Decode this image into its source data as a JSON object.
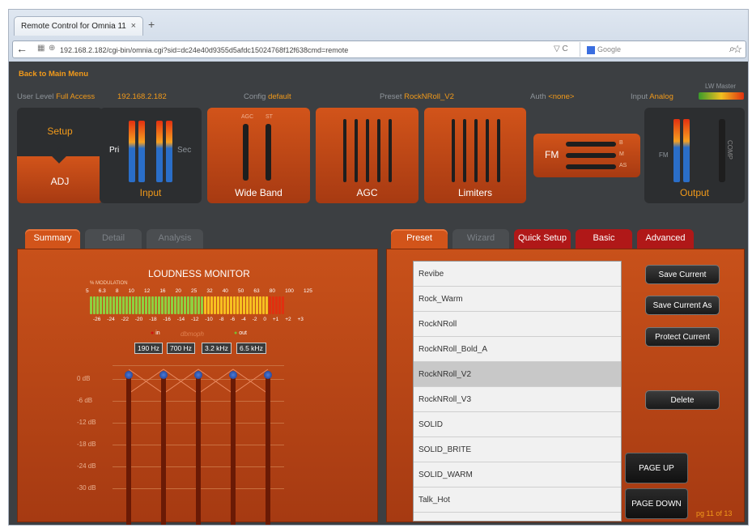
{
  "browser": {
    "tab_title": "Remote Control for Omnia 11",
    "close": "×",
    "new_tab": "+",
    "back": "←",
    "url": "192.168.2.182/cgi-bin/omnia.cgi?sid=dc24e40d9355d5afdc15024768f12f638cmd=remote",
    "search_placeholder": "Google",
    "reload": "▽ C",
    "star": "☆",
    "search_icon": "⌕"
  },
  "app": {
    "back_to_main": "Back to Main Menu",
    "user_level_label": "User Level",
    "user_level": "Full Access",
    "ip": "192.168.2.182",
    "config_label": "Config",
    "config": "default",
    "preset_label": "Preset",
    "preset": "RockNRoll_V2",
    "auth_label": "Auth",
    "auth": "<none>",
    "input_label": "Input",
    "input": "Analog",
    "lw_master": "LW Master"
  },
  "chain": {
    "setup": "Setup",
    "adj": "ADJ",
    "input": "Input",
    "pri": "Pri",
    "sec": "Sec",
    "wideband": "Wide Band",
    "agc_l": "AGC",
    "st_l": "ST",
    "agc": "AGC",
    "limiters": "Limiters",
    "fm": "FM",
    "b": "B",
    "m": "M",
    "as": "AS",
    "output": "Output",
    "out_fm": "FM",
    "comp": "COMP"
  },
  "left_tabs": {
    "summary": "Summary",
    "detail": "Detail",
    "analysis": "Analysis"
  },
  "right_tabs": {
    "preset": "Preset",
    "wizard": "Wizard",
    "quick_setup": "Quick Setup",
    "basic": "Basic",
    "advanced": "Advanced"
  },
  "loudness": {
    "title": "LOUDNESS MONITOR",
    "in": "in",
    "out": "out",
    "brand": "dbmoph",
    "percent_mod": "% MODULATION",
    "scale_top": [
      "5",
      "6.3",
      "8",
      "10",
      "12",
      "16",
      "20",
      "25",
      "32",
      "40",
      "50",
      "63",
      "80",
      "100",
      "125"
    ],
    "scale_bottom": [
      "-26",
      "-24",
      "-22",
      "-20",
      "-18",
      "-16",
      "-14",
      "-12",
      "-10",
      "-8",
      "-6",
      "-4",
      "-2",
      "0",
      "+1",
      "+2",
      "+3"
    ]
  },
  "eq": {
    "freqs": [
      "190 Hz",
      "700 Hz",
      "3.2 kHz",
      "6.5 kHz"
    ],
    "db": [
      "0 dB",
      "-6 dB",
      "-12 dB",
      "-18 dB",
      "-24 dB",
      "-30 dB"
    ]
  },
  "presets": [
    "Revibe",
    "Rock_Warm",
    "RockNRoll",
    "RockNRoll_Bold_A",
    "RockNRoll_V2",
    "RockNRoll_V3",
    "SOLID",
    "SOLID_BRITE",
    "SOLID_WARM",
    "Talk_Hot"
  ],
  "selected_preset": "RockNRoll_V2",
  "buttons": {
    "save_current": "Save Current",
    "save_current_as": "Save Current As",
    "protect_current": "Protect Current",
    "delete": "Delete",
    "page_up": "PAGE UP",
    "page_down": "PAGE DOWN"
  },
  "page_indicator": "pg 11 of 13",
  "colors": {
    "accent": "#d2541a",
    "orange_text": "#f29a1a"
  }
}
